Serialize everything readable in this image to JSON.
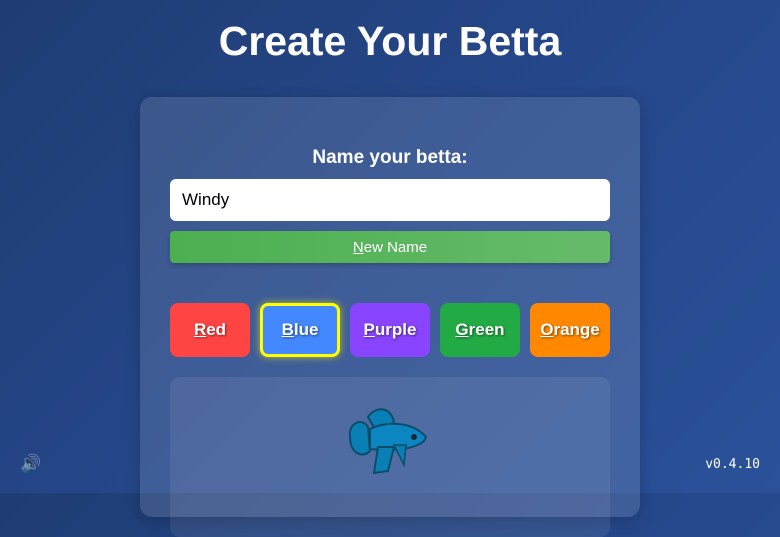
{
  "title": "Create Your Betta",
  "name_label": "Name your betta:",
  "name_value": "Windy",
  "new_name": {
    "key": "N",
    "rest": "ew Name"
  },
  "colors": [
    {
      "key": "R",
      "rest": "ed",
      "hex": "#ff4444"
    },
    {
      "key": "B",
      "rest": "lue",
      "hex": "#4488ff",
      "selected": true
    },
    {
      "key": "P",
      "rest": "urple",
      "hex": "#8844ff"
    },
    {
      "key": "G",
      "rest": "reen",
      "hex": "#22aa44"
    },
    {
      "key": "O",
      "rest": "range",
      "hex": "#ff8800"
    }
  ],
  "sound_icon": "🔊",
  "version": "v0.4.10"
}
